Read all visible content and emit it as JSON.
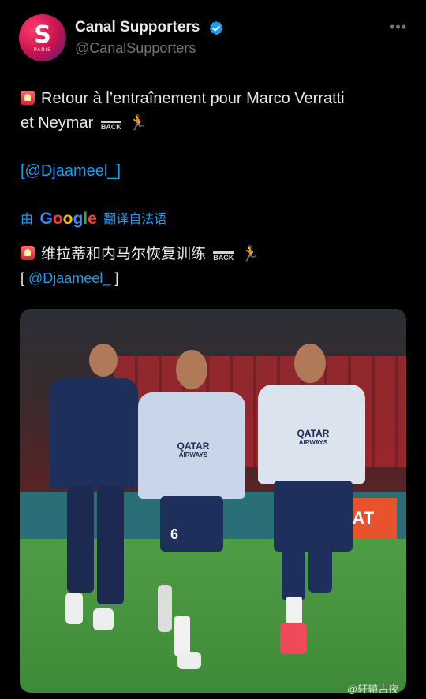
{
  "account": {
    "name": "Canal Supporters",
    "handle": "@CanalSupporters",
    "avatar_letter": "S",
    "avatar_sub": "PARIS",
    "verified_color": "#1d9bf0"
  },
  "tweet": {
    "line1": "Retour à l’entraînement pour Marco Verratti",
    "line2": "et Neymar",
    "back_label": "BACK",
    "link": "[@Djaameel_]"
  },
  "translation": {
    "prefix": "由",
    "provider": "Google",
    "suffix": "翻译自法语",
    "line1": "维拉蒂和内马尔恢复训练",
    "back_label": "BACK",
    "link_open": "[",
    "link": "@Djaameel_",
    "link_close": "]"
  },
  "media": {
    "board_text": "EAT",
    "shirt_sponsor_1": "QATAR",
    "shirt_sponsor_2": "AIRWAYS",
    "shirt_number": "6"
  },
  "watermark": "@轩辕古夜",
  "colors": {
    "background": "#000000",
    "text": "#e7e9ea",
    "muted": "#71767b",
    "link": "#1d9bf0"
  }
}
